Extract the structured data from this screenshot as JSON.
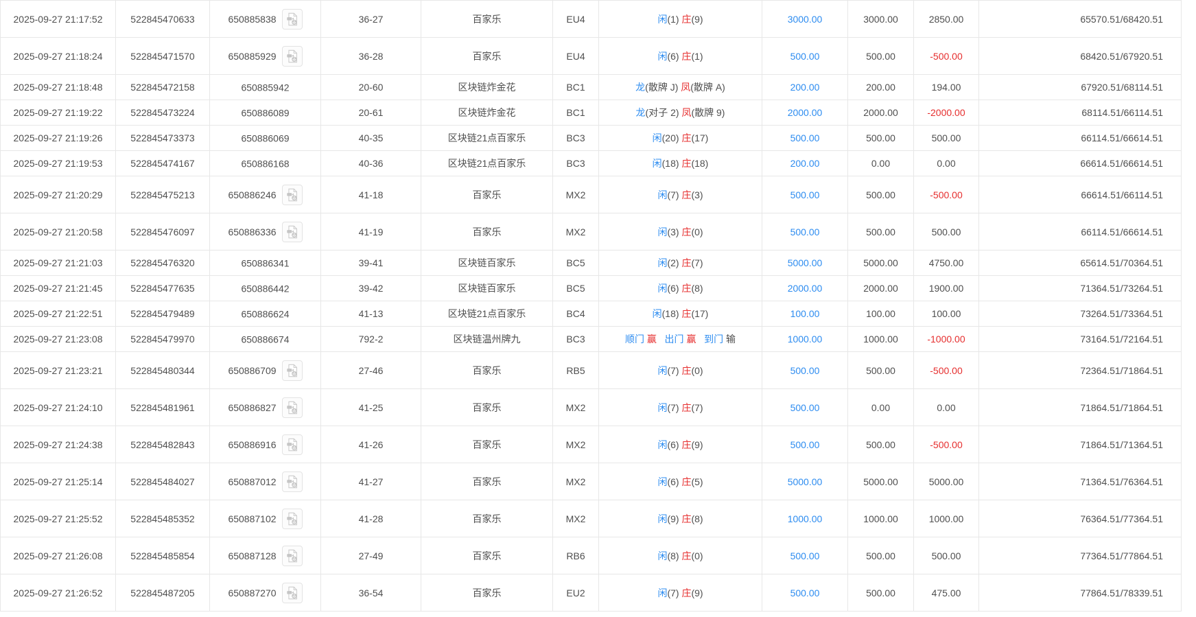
{
  "colors": {
    "link_blue": "#2d8cf0",
    "loss_red": "#e62e2e",
    "text_dark": "#4f4f4f",
    "row_border": "#e7e7e7"
  },
  "icons": {
    "video_replay": "video-file-icon"
  },
  "table": {
    "rows": [
      {
        "time": "2025-09-27 21:17:52",
        "bet_id": "522845470633",
        "round_id": "650885838",
        "has_video": true,
        "table_round": "36-27",
        "game": "百家乐",
        "table_code": "EU4",
        "result": [
          {
            "t": "闲",
            "c": "blue"
          },
          {
            "t": "(1) ",
            "c": "dark"
          },
          {
            "t": "庄",
            "c": "red"
          },
          {
            "t": "(9)",
            "c": "dark"
          }
        ],
        "bet_amount": "3000.00",
        "valid_amount": "3000.00",
        "win_loss": "2850.00",
        "balance": "65570.51/68420.51"
      },
      {
        "time": "2025-09-27 21:18:24",
        "bet_id": "522845471570",
        "round_id": "650885929",
        "has_video": true,
        "table_round": "36-28",
        "game": "百家乐",
        "table_code": "EU4",
        "result": [
          {
            "t": "闲",
            "c": "blue"
          },
          {
            "t": "(6) ",
            "c": "dark"
          },
          {
            "t": "庄",
            "c": "red"
          },
          {
            "t": "(1)",
            "c": "dark"
          }
        ],
        "bet_amount": "500.00",
        "valid_amount": "500.00",
        "win_loss": "-500.00",
        "balance": "68420.51/67920.51"
      },
      {
        "time": "2025-09-27 21:18:48",
        "bet_id": "522845472158",
        "round_id": "650885942",
        "has_video": false,
        "table_round": "20-60",
        "game": "区块链炸金花",
        "table_code": "BC1",
        "result": [
          {
            "t": "龙",
            "c": "blue"
          },
          {
            "t": "(散牌 J) ",
            "c": "dark"
          },
          {
            "t": "凤",
            "c": "red"
          },
          {
            "t": "(散牌 A)",
            "c": "dark"
          }
        ],
        "bet_amount": "200.00",
        "valid_amount": "200.00",
        "win_loss": "194.00",
        "balance": "67920.51/68114.51"
      },
      {
        "time": "2025-09-27 21:19:22",
        "bet_id": "522845473224",
        "round_id": "650886089",
        "has_video": false,
        "table_round": "20-61",
        "game": "区块链炸金花",
        "table_code": "BC1",
        "result": [
          {
            "t": "龙",
            "c": "blue"
          },
          {
            "t": "(对子 2) ",
            "c": "dark"
          },
          {
            "t": "凤",
            "c": "red"
          },
          {
            "t": "(散牌 9)",
            "c": "dark"
          }
        ],
        "bet_amount": "2000.00",
        "valid_amount": "2000.00",
        "win_loss": "-2000.00",
        "balance": "68114.51/66114.51"
      },
      {
        "time": "2025-09-27 21:19:26",
        "bet_id": "522845473373",
        "round_id": "650886069",
        "has_video": false,
        "table_round": "40-35",
        "game": "区块链21点百家乐",
        "table_code": "BC3",
        "result": [
          {
            "t": "闲",
            "c": "blue"
          },
          {
            "t": "(20) ",
            "c": "dark"
          },
          {
            "t": "庄",
            "c": "red"
          },
          {
            "t": "(17)",
            "c": "dark"
          }
        ],
        "bet_amount": "500.00",
        "valid_amount": "500.00",
        "win_loss": "500.00",
        "balance": "66114.51/66614.51"
      },
      {
        "time": "2025-09-27 21:19:53",
        "bet_id": "522845474167",
        "round_id": "650886168",
        "has_video": false,
        "table_round": "40-36",
        "game": "区块链21点百家乐",
        "table_code": "BC3",
        "result": [
          {
            "t": "闲",
            "c": "blue"
          },
          {
            "t": "(18) ",
            "c": "dark"
          },
          {
            "t": "庄",
            "c": "red"
          },
          {
            "t": "(18)",
            "c": "dark"
          }
        ],
        "bet_amount": "200.00",
        "valid_amount": "0.00",
        "win_loss": "0.00",
        "balance": "66614.51/66614.51"
      },
      {
        "time": "2025-09-27 21:20:29",
        "bet_id": "522845475213",
        "round_id": "650886246",
        "has_video": true,
        "table_round": "41-18",
        "game": "百家乐",
        "table_code": "MX2",
        "result": [
          {
            "t": "闲",
            "c": "blue"
          },
          {
            "t": "(7) ",
            "c": "dark"
          },
          {
            "t": "庄",
            "c": "red"
          },
          {
            "t": "(3)",
            "c": "dark"
          }
        ],
        "bet_amount": "500.00",
        "valid_amount": "500.00",
        "win_loss": "-500.00",
        "balance": "66614.51/66114.51"
      },
      {
        "time": "2025-09-27 21:20:58",
        "bet_id": "522845476097",
        "round_id": "650886336",
        "has_video": true,
        "table_round": "41-19",
        "game": "百家乐",
        "table_code": "MX2",
        "result": [
          {
            "t": "闲",
            "c": "blue"
          },
          {
            "t": "(3) ",
            "c": "dark"
          },
          {
            "t": "庄",
            "c": "red"
          },
          {
            "t": "(0)",
            "c": "dark"
          }
        ],
        "bet_amount": "500.00",
        "valid_amount": "500.00",
        "win_loss": "500.00",
        "balance": "66114.51/66614.51"
      },
      {
        "time": "2025-09-27 21:21:03",
        "bet_id": "522845476320",
        "round_id": "650886341",
        "has_video": false,
        "table_round": "39-41",
        "game": "区块链百家乐",
        "table_code": "BC5",
        "result": [
          {
            "t": "闲",
            "c": "blue"
          },
          {
            "t": "(2) ",
            "c": "dark"
          },
          {
            "t": "庄",
            "c": "red"
          },
          {
            "t": "(7)",
            "c": "dark"
          }
        ],
        "bet_amount": "5000.00",
        "valid_amount": "5000.00",
        "win_loss": "4750.00",
        "balance": "65614.51/70364.51"
      },
      {
        "time": "2025-09-27 21:21:45",
        "bet_id": "522845477635",
        "round_id": "650886442",
        "has_video": false,
        "table_round": "39-42",
        "game": "区块链百家乐",
        "table_code": "BC5",
        "result": [
          {
            "t": "闲",
            "c": "blue"
          },
          {
            "t": "(6) ",
            "c": "dark"
          },
          {
            "t": "庄",
            "c": "red"
          },
          {
            "t": "(8)",
            "c": "dark"
          }
        ],
        "bet_amount": "2000.00",
        "valid_amount": "2000.00",
        "win_loss": "1900.00",
        "balance": "71364.51/73264.51"
      },
      {
        "time": "2025-09-27 21:22:51",
        "bet_id": "522845479489",
        "round_id": "650886624",
        "has_video": false,
        "table_round": "41-13",
        "game": "区块链21点百家乐",
        "table_code": "BC4",
        "result": [
          {
            "t": "闲",
            "c": "blue"
          },
          {
            "t": "(18) ",
            "c": "dark"
          },
          {
            "t": "庄",
            "c": "red"
          },
          {
            "t": "(17)",
            "c": "dark"
          }
        ],
        "bet_amount": "100.00",
        "valid_amount": "100.00",
        "win_loss": "100.00",
        "balance": "73264.51/73364.51"
      },
      {
        "time": "2025-09-27 21:23:08",
        "bet_id": "522845479970",
        "round_id": "650886674",
        "has_video": false,
        "table_round": "792-2",
        "game": "区块链温州牌九",
        "table_code": "BC3",
        "result": [
          {
            "t": "顺门 ",
            "c": "blue"
          },
          {
            "t": "赢",
            "c": "red"
          },
          {
            "t": "   ",
            "c": "dark"
          },
          {
            "t": "出门 ",
            "c": "blue"
          },
          {
            "t": "赢",
            "c": "red"
          },
          {
            "t": "   ",
            "c": "dark"
          },
          {
            "t": "到门 ",
            "c": "blue"
          },
          {
            "t": "输",
            "c": "dark"
          }
        ],
        "bet_amount": "1000.00",
        "valid_amount": "1000.00",
        "win_loss": "-1000.00",
        "balance": "73164.51/72164.51"
      },
      {
        "time": "2025-09-27 21:23:21",
        "bet_id": "522845480344",
        "round_id": "650886709",
        "has_video": true,
        "table_round": "27-46",
        "game": "百家乐",
        "table_code": "RB5",
        "result": [
          {
            "t": "闲",
            "c": "blue"
          },
          {
            "t": "(7) ",
            "c": "dark"
          },
          {
            "t": "庄",
            "c": "red"
          },
          {
            "t": "(0)",
            "c": "dark"
          }
        ],
        "bet_amount": "500.00",
        "valid_amount": "500.00",
        "win_loss": "-500.00",
        "balance": "72364.51/71864.51"
      },
      {
        "time": "2025-09-27 21:24:10",
        "bet_id": "522845481961",
        "round_id": "650886827",
        "has_video": true,
        "table_round": "41-25",
        "game": "百家乐",
        "table_code": "MX2",
        "result": [
          {
            "t": "闲",
            "c": "blue"
          },
          {
            "t": "(7) ",
            "c": "dark"
          },
          {
            "t": "庄",
            "c": "red"
          },
          {
            "t": "(7)",
            "c": "dark"
          }
        ],
        "bet_amount": "500.00",
        "valid_amount": "0.00",
        "win_loss": "0.00",
        "balance": "71864.51/71864.51"
      },
      {
        "time": "2025-09-27 21:24:38",
        "bet_id": "522845482843",
        "round_id": "650886916",
        "has_video": true,
        "table_round": "41-26",
        "game": "百家乐",
        "table_code": "MX2",
        "result": [
          {
            "t": "闲",
            "c": "blue"
          },
          {
            "t": "(6) ",
            "c": "dark"
          },
          {
            "t": "庄",
            "c": "red"
          },
          {
            "t": "(9)",
            "c": "dark"
          }
        ],
        "bet_amount": "500.00",
        "valid_amount": "500.00",
        "win_loss": "-500.00",
        "balance": "71864.51/71364.51"
      },
      {
        "time": "2025-09-27 21:25:14",
        "bet_id": "522845484027",
        "round_id": "650887012",
        "has_video": true,
        "table_round": "41-27",
        "game": "百家乐",
        "table_code": "MX2",
        "result": [
          {
            "t": "闲",
            "c": "blue"
          },
          {
            "t": "(6) ",
            "c": "dark"
          },
          {
            "t": "庄",
            "c": "red"
          },
          {
            "t": "(5)",
            "c": "dark"
          }
        ],
        "bet_amount": "5000.00",
        "valid_amount": "5000.00",
        "win_loss": "5000.00",
        "balance": "71364.51/76364.51"
      },
      {
        "time": "2025-09-27 21:25:52",
        "bet_id": "522845485352",
        "round_id": "650887102",
        "has_video": true,
        "table_round": "41-28",
        "game": "百家乐",
        "table_code": "MX2",
        "result": [
          {
            "t": "闲",
            "c": "blue"
          },
          {
            "t": "(9) ",
            "c": "dark"
          },
          {
            "t": "庄",
            "c": "red"
          },
          {
            "t": "(8)",
            "c": "dark"
          }
        ],
        "bet_amount": "1000.00",
        "valid_amount": "1000.00",
        "win_loss": "1000.00",
        "balance": "76364.51/77364.51"
      },
      {
        "time": "2025-09-27 21:26:08",
        "bet_id": "522845485854",
        "round_id": "650887128",
        "has_video": true,
        "table_round": "27-49",
        "game": "百家乐",
        "table_code": "RB6",
        "result": [
          {
            "t": "闲",
            "c": "blue"
          },
          {
            "t": "(8) ",
            "c": "dark"
          },
          {
            "t": "庄",
            "c": "red"
          },
          {
            "t": "(0)",
            "c": "dark"
          }
        ],
        "bet_amount": "500.00",
        "valid_amount": "500.00",
        "win_loss": "500.00",
        "balance": "77364.51/77864.51"
      },
      {
        "time": "2025-09-27 21:26:52",
        "bet_id": "522845487205",
        "round_id": "650887270",
        "has_video": true,
        "table_round": "36-54",
        "game": "百家乐",
        "table_code": "EU2",
        "result": [
          {
            "t": "闲",
            "c": "blue"
          },
          {
            "t": "(7) ",
            "c": "dark"
          },
          {
            "t": "庄",
            "c": "red"
          },
          {
            "t": "(9)",
            "c": "dark"
          }
        ],
        "bet_amount": "500.00",
        "valid_amount": "500.00",
        "win_loss": "475.00",
        "balance": "77864.51/78339.51"
      }
    ]
  }
}
